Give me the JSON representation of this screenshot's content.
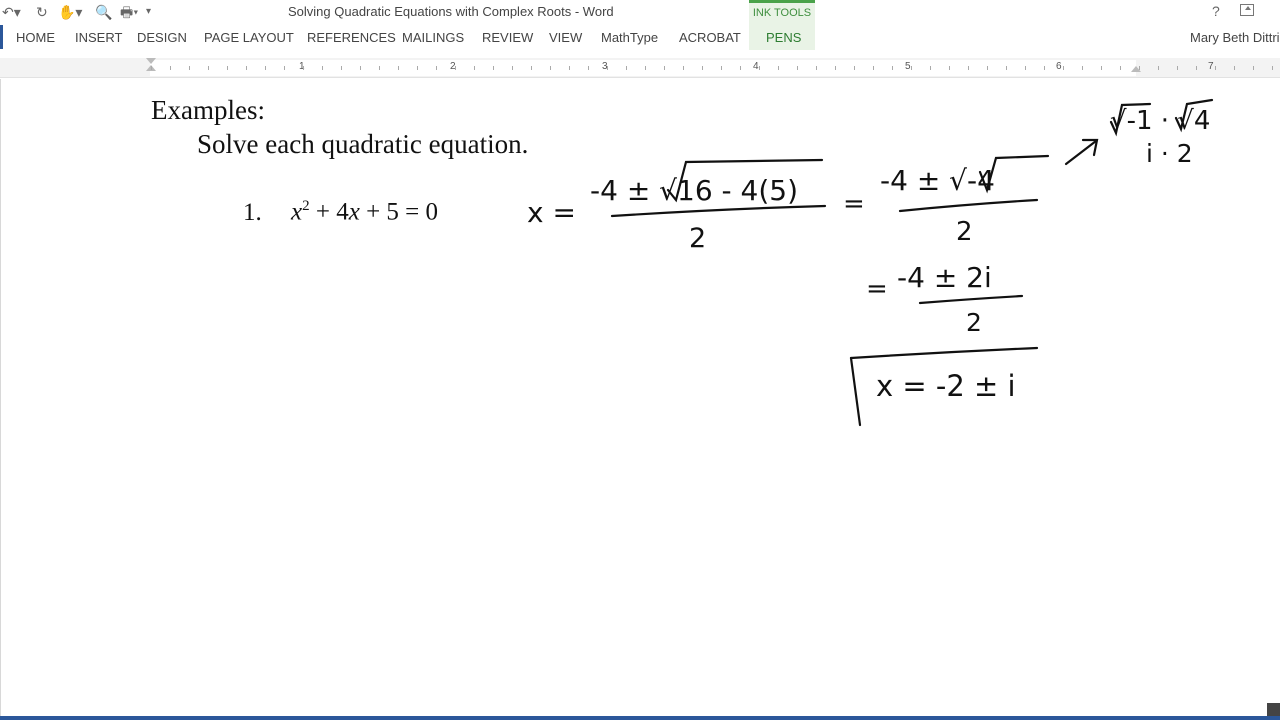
{
  "window": {
    "title": "Solving Quadratic Equations with Complex Roots - Word",
    "contextual_tab_group": "INK TOOLS",
    "user": "Mary Beth Dittri"
  },
  "quick_access": {
    "icons": [
      "undo-icon",
      "redo-icon",
      "touch-mode-icon",
      "print-preview-icon",
      "quick-print-icon",
      "customize-dropdown-icon"
    ]
  },
  "ribbon": {
    "tabs": [
      "HOME",
      "INSERT",
      "DESIGN",
      "PAGE LAYOUT",
      "REFERENCES",
      "MAILINGS",
      "REVIEW",
      "VIEW",
      "MathType",
      "ACROBAT",
      "PENS"
    ],
    "active_tab": "PENS"
  },
  "ruler": {
    "numbers": [
      "1",
      "2",
      "3",
      "4",
      "5",
      "6",
      "7"
    ]
  },
  "document": {
    "heading": "Examples:",
    "instruction": "Solve each quadratic equation.",
    "problem_number": "1.",
    "equation": {
      "x": "x",
      "exp": "2",
      "rest1": " + 4",
      "x2": "x",
      "rest2": " + 5 = 0"
    }
  },
  "ink": {
    "step1_numerator": "-4 ± √16 - 4(5)",
    "step1_lhs": "x =",
    "step1_denominator": "2",
    "step2_numerator": "-4 ± √-4",
    "step2_denominator": "2",
    "side_line1": "√-1 · √4",
    "side_line2": "i · 2",
    "step3_numerator": "-4 ± 2i",
    "step3_denominator": "2",
    "answer": "x = -2 ± i"
  },
  "colors": {
    "word_blue": "#2b579a",
    "ink_tools_green": "#4aa24a"
  }
}
